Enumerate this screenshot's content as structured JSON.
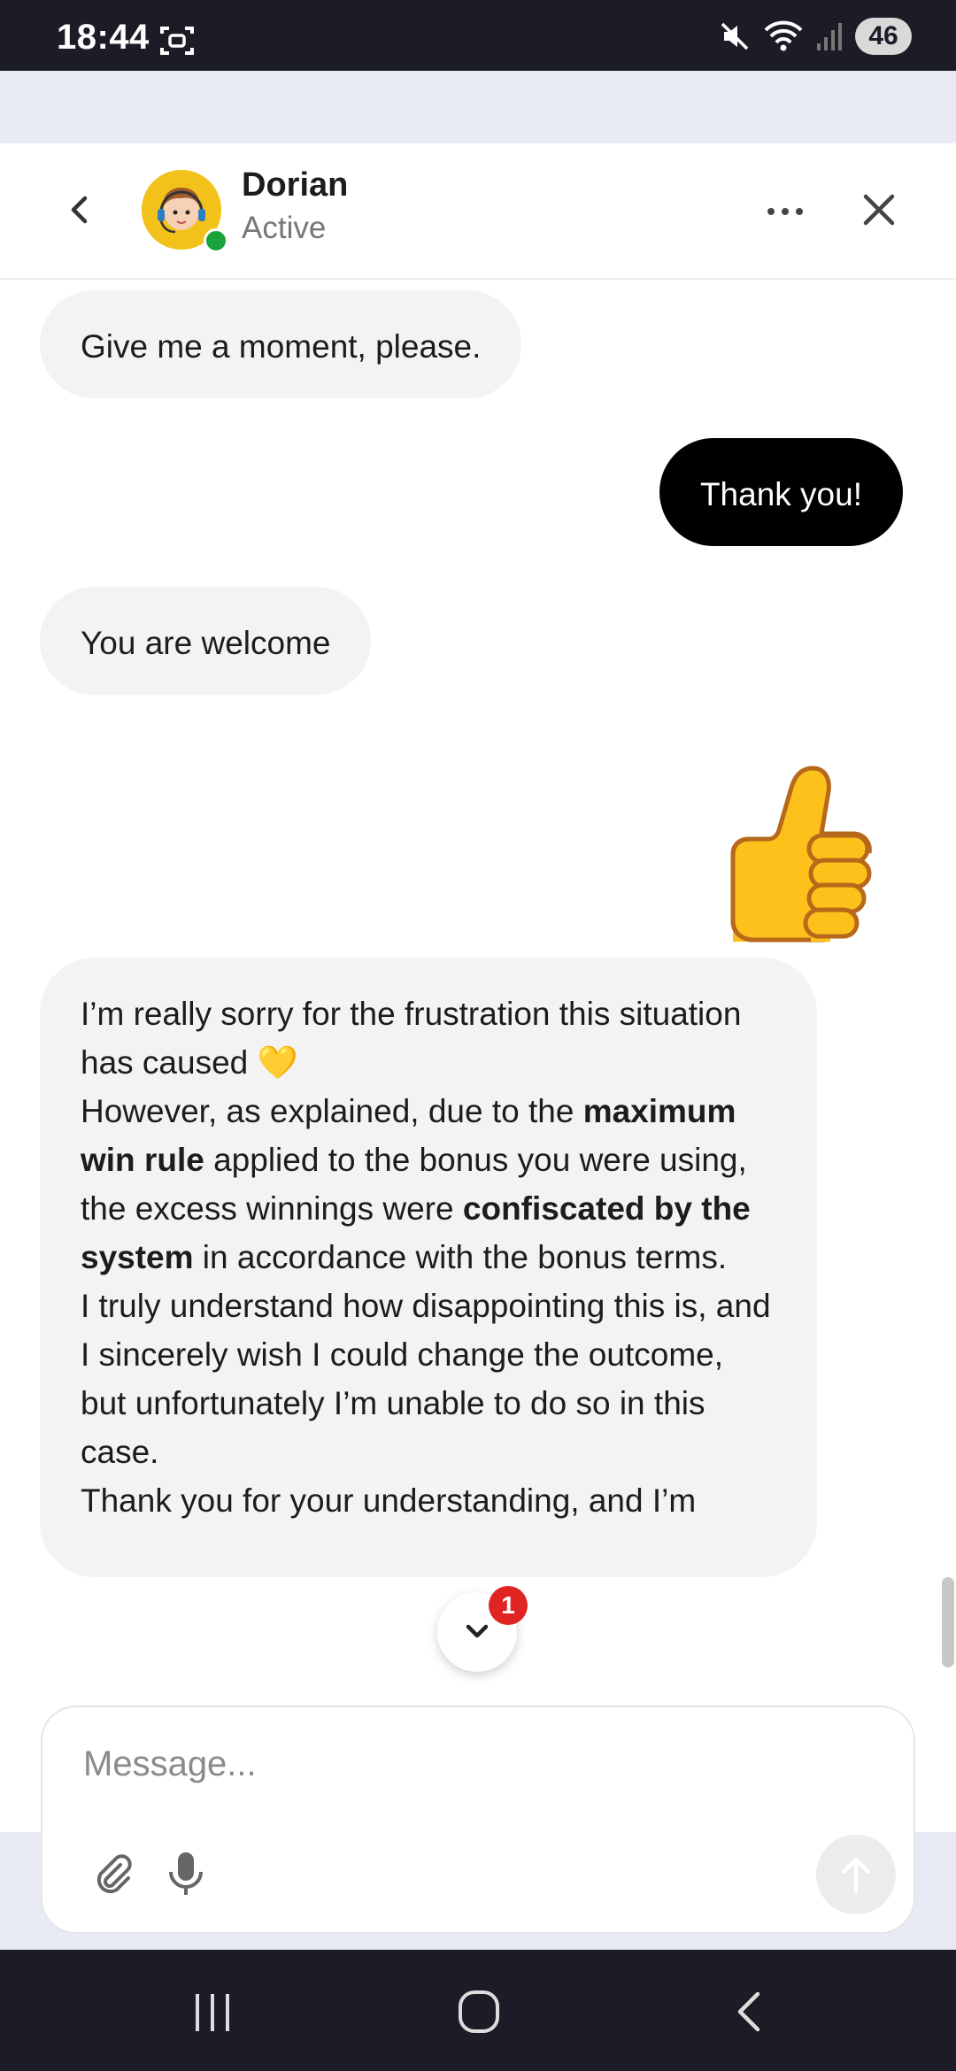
{
  "status_bar": {
    "time": "18:44",
    "battery": "46",
    "icons": [
      "screenshot-icon",
      "mute-icon",
      "wifi-icon",
      "signal-icon",
      "battery-icon"
    ]
  },
  "header": {
    "agent_name": "Dorian",
    "agent_status": "Active",
    "status_color": "#1aa33a"
  },
  "messages": [
    {
      "sender": "agent",
      "text": "Give me a moment, please."
    },
    {
      "sender": "user",
      "text": "Thank you!"
    },
    {
      "sender": "agent",
      "text": "You are welcome"
    },
    {
      "sender": "user",
      "emoji": "thumbs-up"
    },
    {
      "sender": "agent",
      "segments": {
        "s1": "I’m really sorry for the frustration this situation has caused 💛",
        "s2": "However, as explained, due to the ",
        "s3": "maximum win rule",
        "s4": " applied to the bonus you were using, the excess winnings were ",
        "s5": "confiscated by the system",
        "s6": " in accordance with the bonus terms.",
        "s7": "I truly understand how disappointing this is, and I sincerely wish I could change the outcome, but unfortunately I’m unable to do so in this case.",
        "s8": "Thank you for your understanding, and I’m"
      }
    }
  ],
  "scroll_down": {
    "unread_count": "1"
  },
  "composer": {
    "placeholder": "Message..."
  },
  "colors": {
    "accent_outgoing": "#000000",
    "incoming_bubble": "#f3f3f3",
    "badge": "#e02424"
  }
}
